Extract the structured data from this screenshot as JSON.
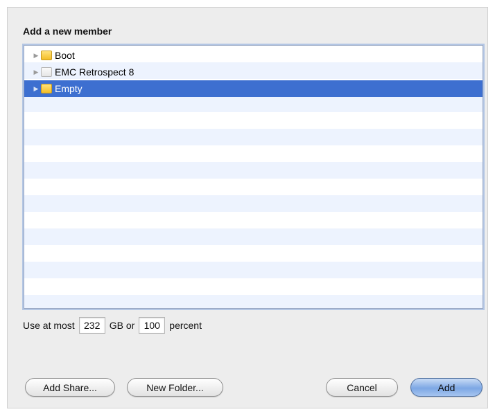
{
  "dialog": {
    "title": "Add a new member",
    "members": [
      {
        "label": "Boot",
        "icon": "folder-icon",
        "selected": false
      },
      {
        "label": "EMC Retrospect 8",
        "icon": "drive-icon",
        "selected": false
      },
      {
        "label": "Empty",
        "icon": "folder-icon",
        "selected": true
      }
    ],
    "limit": {
      "prefix": "Use at most",
      "gb_value": "232",
      "gb_unit": "GB or",
      "percent_value": "100",
      "percent_unit": "percent"
    },
    "buttons": {
      "add_share": "Add Share...",
      "new_folder": "New Folder...",
      "cancel": "Cancel",
      "add": "Add"
    },
    "colors": {
      "selection": "#3d6fd0",
      "default_button": "#7da7e4",
      "folder": "#f4bd26"
    }
  }
}
